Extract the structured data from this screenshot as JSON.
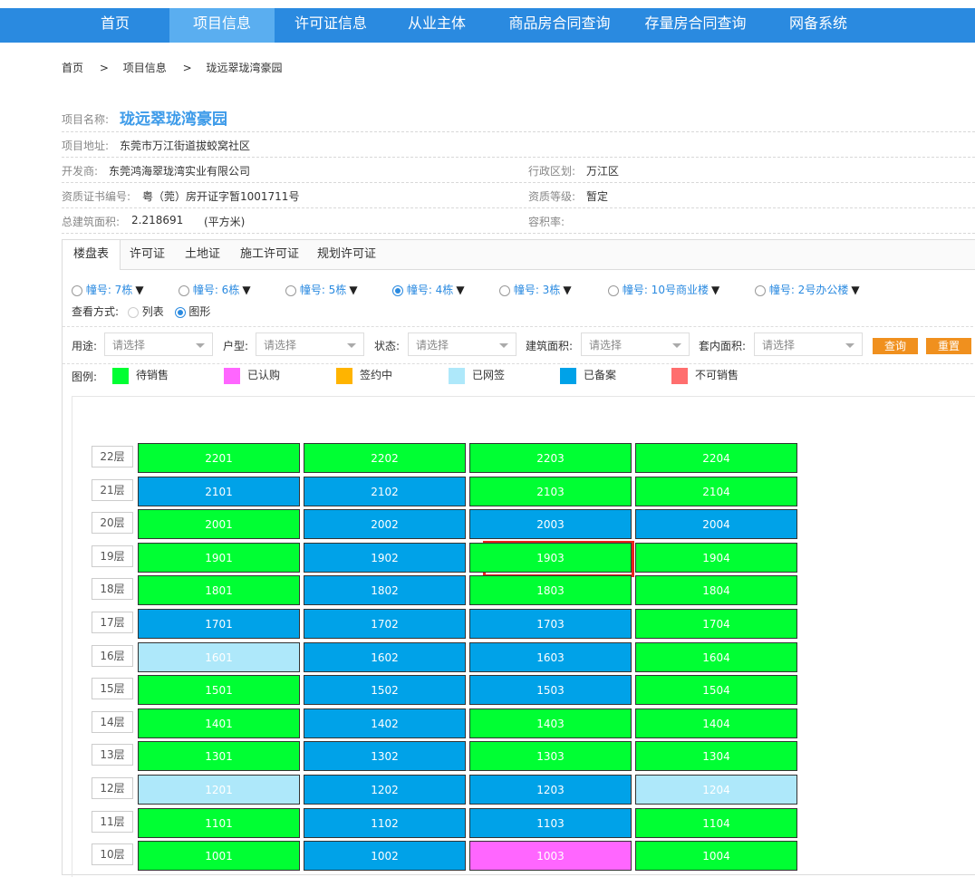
{
  "nav": {
    "items": [
      {
        "label": "首页"
      },
      {
        "label": "项目信息",
        "active": true
      },
      {
        "label": "许可证信息"
      },
      {
        "label": "从业主体"
      },
      {
        "label": "商品房合同查询"
      },
      {
        "label": "存量房合同查询"
      },
      {
        "label": "网备系统"
      }
    ]
  },
  "breadcrumb": [
    "首页",
    ">",
    "项目信息",
    ">",
    "珑远翠珑湾豪园"
  ],
  "project": {
    "name_label": "项目名称:",
    "name": "珑远翠珑湾豪园",
    "address_label": "项目地址:",
    "address": "东莞市万江街道拔蛟窝社区",
    "developer_label": "开发商:",
    "developer": "东莞鸿海翠珑湾实业有限公司",
    "district_label": "行政区划:",
    "district": "万江区",
    "cert_label": "资质证书编号:",
    "cert": "粤（莞）房开证字暂1001711号",
    "grade_label": "资质等级:",
    "grade": "暂定",
    "area_label": "总建筑面积:",
    "area": "2.218691",
    "area_unit": "(平方米)",
    "far_label": "容积率:"
  },
  "tabs": [
    "楼盘表",
    "许可证",
    "土地证",
    "施工许可证",
    "规划许可证"
  ],
  "buildings": [
    {
      "label": "幢号: 7栋",
      "selected": false
    },
    {
      "label": "幢号: 6栋",
      "selected": false
    },
    {
      "label": "幢号: 5栋",
      "selected": false
    },
    {
      "label": "幢号: 4栋",
      "selected": true
    },
    {
      "label": "幢号: 3栋",
      "selected": false
    },
    {
      "label": "幢号: 10号商业楼",
      "selected": false
    },
    {
      "label": "幢号: 2号办公楼",
      "selected": false
    }
  ],
  "view": {
    "label": "查看方式:",
    "list": "列表",
    "graph": "图形",
    "selected": "graph"
  },
  "filters": {
    "usage_label": "用途:",
    "type_label": "户型:",
    "status_label": "状态:",
    "build_area_label": "建筑面积:",
    "inner_area_label": "套内面积:",
    "placeholder": "请选择",
    "query_btn": "查询",
    "reset_btn": "重置"
  },
  "legend": {
    "label": "图例:",
    "items": [
      {
        "text": "待销售",
        "color": "#00ff33"
      },
      {
        "text": "已认购",
        "color": "#ff66ff"
      },
      {
        "text": "签约中",
        "color": "#ffb400"
      },
      {
        "text": "已网签",
        "color": "#aee8fa"
      },
      {
        "text": "已备案",
        "color": "#00a2e8"
      },
      {
        "text": "不可销售",
        "color": "#ff6e6e"
      }
    ]
  },
  "floors": [
    {
      "floor": "22层",
      "units": [
        {
          "no": "2201",
          "s": "g"
        },
        {
          "no": "2202",
          "s": "g"
        },
        {
          "no": "2203",
          "s": "g"
        },
        {
          "no": "2204",
          "s": "g"
        }
      ]
    },
    {
      "floor": "21层",
      "units": [
        {
          "no": "2101",
          "s": "b"
        },
        {
          "no": "2102",
          "s": "b"
        },
        {
          "no": "2103",
          "s": "g"
        },
        {
          "no": "2104",
          "s": "g"
        }
      ]
    },
    {
      "floor": "20层",
      "units": [
        {
          "no": "2001",
          "s": "g"
        },
        {
          "no": "2002",
          "s": "b"
        },
        {
          "no": "2003",
          "s": "b"
        },
        {
          "no": "2004",
          "s": "b"
        }
      ]
    },
    {
      "floor": "19层",
      "units": [
        {
          "no": "1901",
          "s": "g"
        },
        {
          "no": "1902",
          "s": "b"
        },
        {
          "no": "1903",
          "s": "g"
        },
        {
          "no": "1904",
          "s": "g"
        }
      ]
    },
    {
      "floor": "18层",
      "units": [
        {
          "no": "1801",
          "s": "g"
        },
        {
          "no": "1802",
          "s": "b"
        },
        {
          "no": "1803",
          "s": "g"
        },
        {
          "no": "1804",
          "s": "g"
        }
      ]
    },
    {
      "floor": "17层",
      "units": [
        {
          "no": "1701",
          "s": "b"
        },
        {
          "no": "1702",
          "s": "b"
        },
        {
          "no": "1703",
          "s": "b"
        },
        {
          "no": "1704",
          "s": "g"
        }
      ]
    },
    {
      "floor": "16层",
      "units": [
        {
          "no": "1601",
          "s": "l"
        },
        {
          "no": "1602",
          "s": "b"
        },
        {
          "no": "1603",
          "s": "b"
        },
        {
          "no": "1604",
          "s": "g"
        }
      ]
    },
    {
      "floor": "15层",
      "units": [
        {
          "no": "1501",
          "s": "g"
        },
        {
          "no": "1502",
          "s": "b"
        },
        {
          "no": "1503",
          "s": "b"
        },
        {
          "no": "1504",
          "s": "g"
        }
      ]
    },
    {
      "floor": "14层",
      "units": [
        {
          "no": "1401",
          "s": "g"
        },
        {
          "no": "1402",
          "s": "b"
        },
        {
          "no": "1403",
          "s": "g"
        },
        {
          "no": "1404",
          "s": "g"
        }
      ]
    },
    {
      "floor": "13层",
      "units": [
        {
          "no": "1301",
          "s": "g"
        },
        {
          "no": "1302",
          "s": "b"
        },
        {
          "no": "1303",
          "s": "g"
        },
        {
          "no": "1304",
          "s": "g"
        }
      ]
    },
    {
      "floor": "12层",
      "units": [
        {
          "no": "1201",
          "s": "l"
        },
        {
          "no": "1202",
          "s": "b"
        },
        {
          "no": "1203",
          "s": "b"
        },
        {
          "no": "1204",
          "s": "l"
        }
      ]
    },
    {
      "floor": "11层",
      "units": [
        {
          "no": "1101",
          "s": "g"
        },
        {
          "no": "1102",
          "s": "b"
        },
        {
          "no": "1103",
          "s": "b"
        },
        {
          "no": "1104",
          "s": "g"
        }
      ]
    },
    {
      "floor": "10层",
      "units": [
        {
          "no": "1001",
          "s": "g"
        },
        {
          "no": "1002",
          "s": "b"
        },
        {
          "no": "1003",
          "s": "p"
        },
        {
          "no": "1004",
          "s": "g"
        }
      ]
    }
  ],
  "status_colors": {
    "g": "#00ff33",
    "b": "#00a2e8",
    "l": "#aee8fa",
    "p": "#ff66ff"
  },
  "highlight_unit": "1903"
}
